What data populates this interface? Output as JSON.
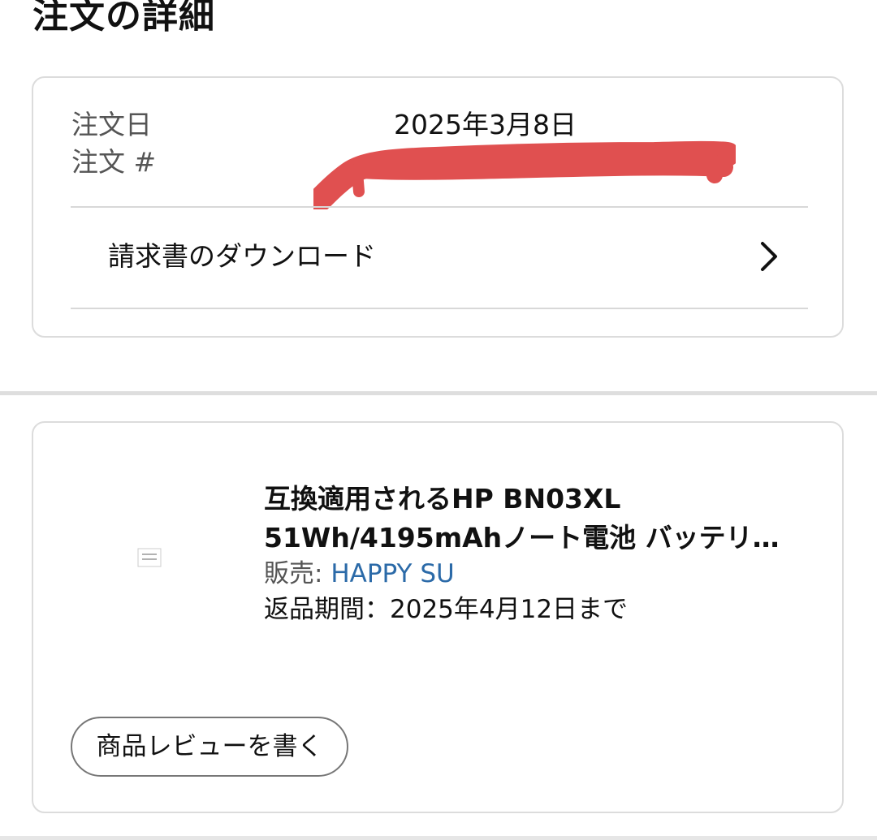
{
  "page": {
    "title": "注文の詳細"
  },
  "order": {
    "date_label": "注文日",
    "date_value": "2025年3月8日",
    "number_label": "注文 #",
    "invoice_label": "請求書のダウンロード",
    "redaction_color": "#e05050"
  },
  "item": {
    "title_line1": "互換適用されるHP BN03XL",
    "title_line2": "51Wh/4195mAhノート電池 バッテリ…",
    "seller_prefix": "販売: ",
    "seller_name": "HAPPY SU",
    "return_period": "返品期間：2025年4月12日まで",
    "review_button": "商品レビューを書く",
    "thumbnail_icon": "image-placeholder-icon"
  },
  "colors": {
    "link": "#2b6aa8",
    "border": "#dcdcdc",
    "muted_text": "#555555"
  }
}
